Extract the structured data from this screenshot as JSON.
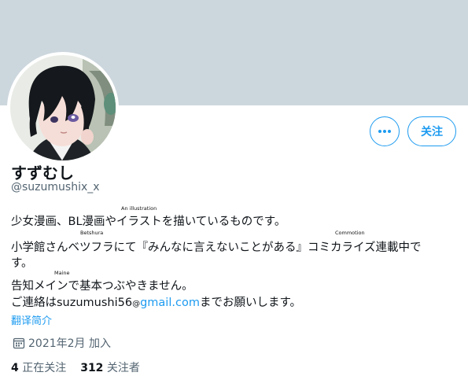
{
  "profile": {
    "display_name": "すずむし",
    "handle": "@suzumushix_x",
    "follow_label": "关注",
    "more_label": "•••"
  },
  "bio": {
    "line1": "少女漫画、BL漫画やイラストを描いているものです。",
    "line2": "小学館さんベツフラにて『みんなに言えないことがある』コミカライズ連載中で",
    "line2_wrap": "す。",
    "line3": "告知メインで基本つぶやきません。",
    "line4_prefix": "ご連絡はsuzumushi56",
    "line4_at": "@",
    "line4_link": "gmail.com",
    "line4_suffix": "までお願いします。"
  },
  "annotations": {
    "illustration": "An illustration",
    "betshura": "Betshura",
    "commotion": "Commotion",
    "maine": "Maine"
  },
  "translate_label": "翻译简介",
  "joined": {
    "icon": "calendar-icon",
    "text": "2021年2月 加入"
  },
  "stats": {
    "following_count": "4",
    "following_label": "正在关注",
    "followers_count": "312",
    "followers_label": "关注者"
  },
  "colors": {
    "banner": "#ccd6dd",
    "accent": "#1d9bf0",
    "secondary_text": "#536471",
    "primary_text": "#0f1419"
  }
}
